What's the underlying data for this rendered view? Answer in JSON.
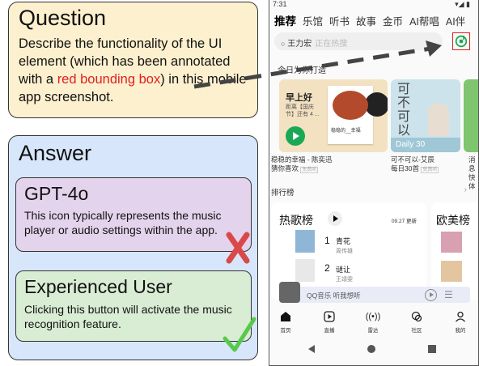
{
  "question": {
    "title": "Question",
    "text_before": "Describe the functionality of the UI element (which has been annotated with a ",
    "text_red": "red bounding box",
    "text_after": ") in this mobile app screenshot."
  },
  "answer": {
    "title": "Answer",
    "gpt": {
      "title": "GPT-4o",
      "text": "This icon typically represents the music player or audio settings within the app."
    },
    "expert": {
      "title": "Experienced User",
      "text": "Clicking this button will activate the music recognition feature."
    }
  },
  "phone": {
    "status": {
      "time": "7:31",
      "right": "▾◢ ▮"
    },
    "tabs": [
      "推荐",
      "乐馆",
      "听书",
      "故事",
      "金币",
      "AI帮唱",
      "AI伴"
    ],
    "search": {
      "placeholder": "王力宏",
      "hot": "正在热搜"
    },
    "today_label": "今日为你打造",
    "card1": {
      "title": "早上好",
      "subtitle": "距离【国庆节】还有 4 ...",
      "cover_caption": "稳稳的__幸福",
      "caption_line1": "稳稳的幸福 - 陈奕迅",
      "caption_line2": "猜你喜欢",
      "tag": "免费听"
    },
    "card2": {
      "chars": "可不可以",
      "badge": "Daily 30",
      "caption_line1": "可不可以-艾辰",
      "caption_line2": "每日30首",
      "tag": "免费听"
    },
    "card3": {
      "caption_line1": "消息",
      "caption_line2": "快体"
    },
    "rank_section": {
      "label": "排行榜",
      "arrow": "›"
    },
    "hot_chart": {
      "title": "热歌榜",
      "date": "09.27 更新",
      "songs": [
        {
          "num": "1",
          "name": "青花",
          "artist": "周传雄"
        },
        {
          "num": "2",
          "name": "谜让",
          "artist": "王靖雯"
        }
      ]
    },
    "west_chart": {
      "title": "欧美榜"
    },
    "miniplayer": {
      "text": "QQ音乐 听我想听"
    },
    "bottom_nav": [
      "首页",
      "直播",
      "雷达",
      "社区",
      "我的"
    ]
  },
  "colors": {
    "question_bg": "#fdf0cf",
    "answer_bg": "#d8e6fb",
    "gpt_bg": "#e4d3ec",
    "expert_bg": "#d9ecd4",
    "highlight_red": "#e02020",
    "accent_green": "#1aa856"
  },
  "icons": [
    "music-recognition-icon",
    "cross-mark-icon",
    "check-mark-icon",
    "dashed-arrow-icon"
  ]
}
